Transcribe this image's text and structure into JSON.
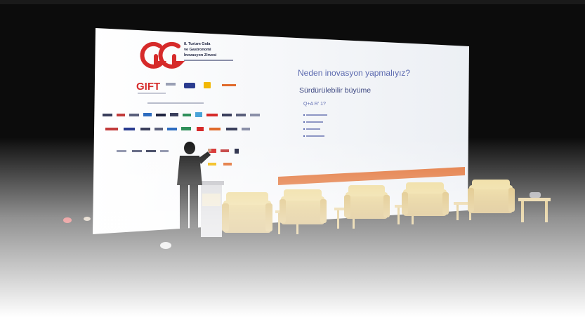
{
  "summit": {
    "title_lines": [
      "8. Turizm Gıda",
      "ve Gastronomi",
      "İnovasyon Zirvesi"
    ]
  },
  "slide": {
    "heading": "Neden inovasyon yapmalıyız?",
    "subheading": "Sürdürülebilir büyüme",
    "qa_line": "Q+A R' 1?"
  },
  "logos": {
    "gift": "GIFT"
  },
  "colors": {
    "stage_dark": "#0c0c0c",
    "screen": "#f4f4f6",
    "brand_red": "#d62a2a",
    "accent_orange": "#e06a2b",
    "chair": "#e2c16a",
    "floor_fade": "#ffffff"
  }
}
